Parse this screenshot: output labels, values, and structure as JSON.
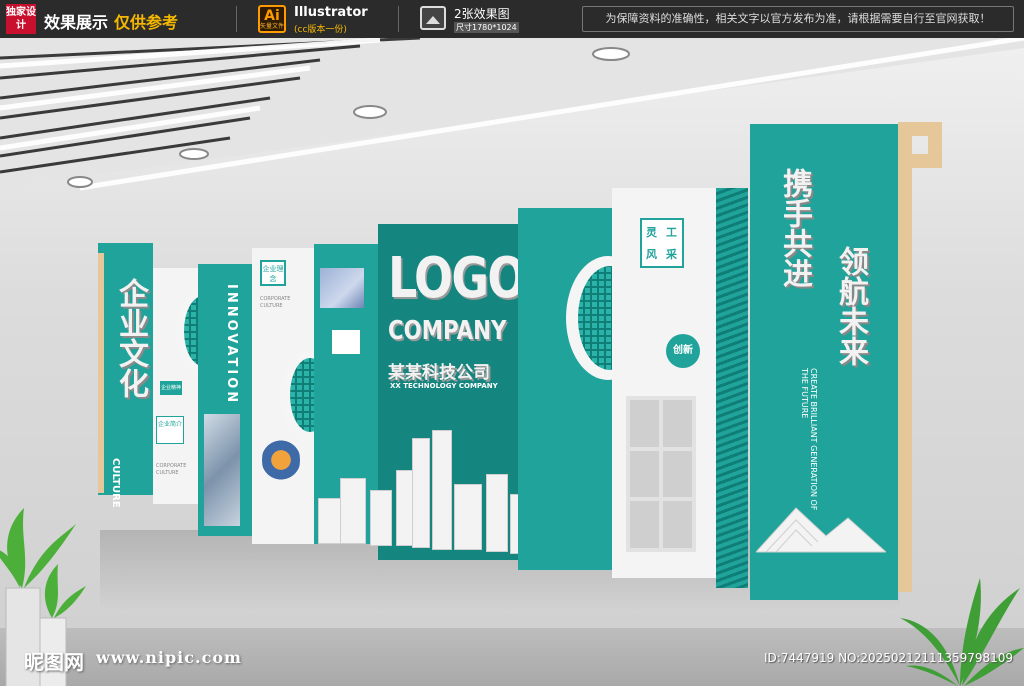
{
  "header": {
    "logo_text": "独家设计",
    "title": "效果展示",
    "title_highlight": "仅供参考",
    "software_icon": "Ai",
    "software_icon_sub": "矢量文件",
    "software_name": "Illustrator",
    "software_version": "(cc版本一份)",
    "image_count": "2张效果图",
    "image_size": "尺寸1780*1024",
    "notice": "为保障资料的准确性，相关文字以官方发布为准，请根据需要自行至官网获取！"
  },
  "wall": {
    "left_vertical_title": "企业文化",
    "left_vertical_sub": "CULTURE",
    "innovation": "INNOVATION",
    "small_badge_1": "企业精神",
    "small_badge_2": "企业简介",
    "corporate_culture_1": "CORPORATE CULTURE",
    "corporate_culture_2": "CORPORATE CULTURE",
    "badge_idea": "企业理念",
    "logo": "LOGO",
    "company": "COMPANY",
    "company_cn": "某某科技公司",
    "company_en": "XX TECHNOLOGY COMPANY",
    "badge_craft_1": "灵",
    "badge_craft_2": "工",
    "badge_craft_3": "风",
    "badge_craft_4": "采",
    "badge_innovate": "创新",
    "slogan_1": "携手共进",
    "slogan_2": "领航未来",
    "slogan_en": "CREATE BRILLIANT GENERATION OF THE FUTURE"
  },
  "footer": {
    "watermark_site": "昵图网",
    "watermark_url": "www.nipic.com",
    "image_id": "ID:7447919 NO:20250212111359798109"
  },
  "colors": {
    "teal": "#1fa39a",
    "teal_dark": "#15867f",
    "wood": "#e6c79a",
    "topbar": "#2b2b2b",
    "accent_yellow": "#f5b800"
  }
}
